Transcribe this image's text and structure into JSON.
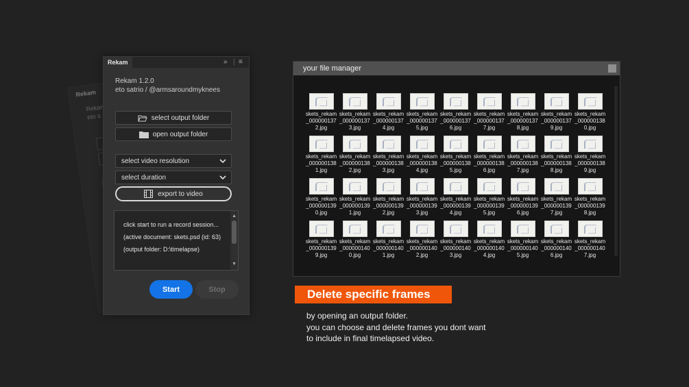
{
  "background_color": "#222222",
  "ghost_panel": {
    "tab": "Rekam",
    "title_lines": [
      "Rekam",
      "eto s"
    ]
  },
  "panel": {
    "tab_label": "Rekam",
    "app_title": "Rekam 1.2.0",
    "author": "eto satrio / @armsaroundmyknees",
    "select_output_folder": "select output folder",
    "open_output_folder": "open output folder",
    "select_video_resolution": "select video resolution",
    "select_duration": "select duration",
    "export_to_video": "export to video",
    "log": [
      "click start to run a record session...",
      "(active document: skets.psd (id: 63)",
      "(output folder: D:\\timelapse)"
    ],
    "start_label": "Start",
    "stop_label": "Stop",
    "accent_color": "#1473e6"
  },
  "file_manager": {
    "title": "your file manager",
    "files": [
      "skets_rekam_0000001372.jpg",
      "skets_rekam_0000001373.jpg",
      "skets_rekam_0000001374.jpg",
      "skets_rekam_0000001375.jpg",
      "skets_rekam_0000001376.jpg",
      "skets_rekam_0000001377.jpg",
      "skets_rekam_0000001378.jpg",
      "skets_rekam_0000001379.jpg",
      "skets_rekam_0000001380.jpg",
      "skets_rekam_0000001381.jpg",
      "skets_rekam_0000001382.jpg",
      "skets_rekam_0000001383.jpg",
      "skets_rekam_0000001384.jpg",
      "skets_rekam_0000001385.jpg",
      "skets_rekam_0000001386.jpg",
      "skets_rekam_0000001387.jpg",
      "skets_rekam_0000001388.jpg",
      "skets_rekam_0000001389.jpg",
      "skets_rekam_0000001390.jpg",
      "skets_rekam_0000001391.jpg",
      "skets_rekam_0000001392.jpg",
      "skets_rekam_0000001393.jpg",
      "skets_rekam_0000001394.jpg",
      "skets_rekam_0000001395.jpg",
      "skets_rekam_0000001396.jpg",
      "skets_rekam_0000001397.jpg",
      "skets_rekam_0000001398.jpg",
      "skets_rekam_0000001399.jpg",
      "skets_rekam_0000001400.jpg",
      "skets_rekam_0000001401.jpg",
      "skets_rekam_0000001402.jpg",
      "skets_rekam_0000001403.jpg",
      "skets_rekam_0000001404.jpg",
      "skets_rekam_0000001405.jpg",
      "skets_rekam_0000001406.jpg",
      "skets_rekam_0000001407.jpg"
    ]
  },
  "banner": {
    "heading": "Delete specific frames",
    "color": "#f0560a",
    "description": [
      "by opening an output folder.",
      "you can choose and delete frames you dont want",
      "to include in final timelapsed video."
    ]
  },
  "icons": [
    "expand-icon",
    "menu-icon",
    "folder-open-icon",
    "folder-icon",
    "chevron-down-icon",
    "film-icon",
    "image-thumbnail-icon"
  ]
}
